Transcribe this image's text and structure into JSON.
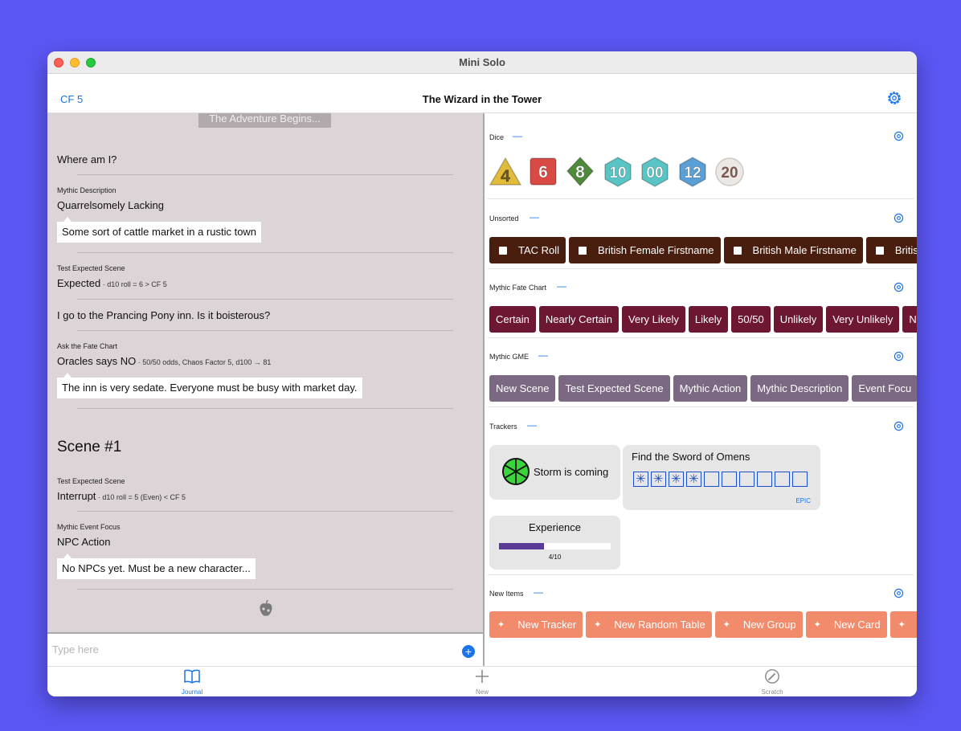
{
  "window": {
    "title": "Mini Solo"
  },
  "navbar": {
    "chaos_factor": "CF 5",
    "title": "The Wizard in the Tower"
  },
  "journal": {
    "adventure_banner": "The Adventure Begins...",
    "entries": [
      {
        "text": "Where am I?"
      },
      {
        "label": "Mythic Description",
        "text": "Quarrelsomely Lacking",
        "note": "Some sort of cattle market in a rustic town"
      },
      {
        "label": "Test Expected Scene",
        "text": "Expected",
        "detail": " · d10 roll = 6 > CF 5"
      },
      {
        "text": "I go to the Prancing Pony inn. Is it boisterous?"
      },
      {
        "label": "Ask the Fate Chart",
        "text": "Oracles says NO",
        "detail": " · 50/50 odds, Chaos Factor 5, d100 → 81",
        "note": "The inn is very sedate. Everyone must be busy with market day."
      },
      {
        "scene_title": "Scene #1"
      },
      {
        "label": "Test Expected Scene",
        "text": "Interrupt",
        "detail": " · d10 roll = 5 (Even) < CF 5"
      },
      {
        "label": "Mythic Event Focus",
        "text": "NPC Action",
        "note": "No NPCs yet. Must be a new character..."
      }
    ],
    "input_placeholder": "Type here"
  },
  "panel": {
    "dice": {
      "label": "Dice",
      "values": [
        "4",
        "6",
        "8",
        "10",
        "00",
        "12",
        "20"
      ],
      "colors": [
        "#e2bb3a",
        "#d94a45",
        "#4f8a3a",
        "#58c4c4",
        "#58c4c4",
        "#5a9fd6",
        "#ece8e6"
      ]
    },
    "unsorted": {
      "label": "Unsorted",
      "items": [
        "TAC Roll",
        "British Female Firstname",
        "British Male Firstname",
        "British S"
      ]
    },
    "fate_chart": {
      "label": "Mythic Fate Chart",
      "items": [
        "Certain",
        "Nearly Certain",
        "Very Likely",
        "Likely",
        "50/50",
        "Unlikely",
        "Very Unlikely",
        "N"
      ]
    },
    "gme": {
      "label": "Mythic GME",
      "items": [
        "New Scene",
        "Test Expected Scene",
        "Mythic Action",
        "Mythic Description",
        "Event Focu"
      ]
    },
    "trackers": {
      "label": "Trackers",
      "storm": {
        "label": "Storm is coming"
      },
      "sword": {
        "title": "Find the Sword of Omens",
        "filled": 4,
        "total": 10,
        "tag": "EPIC"
      },
      "experience": {
        "title": "Experience",
        "value": 4,
        "max": 10,
        "value_text": "4/10"
      }
    },
    "new_items": {
      "label": "New Items",
      "items": [
        "New Tracker",
        "New Random Table",
        "New Group",
        "New Card",
        "N"
      ]
    }
  },
  "tabbar": {
    "tabs": [
      {
        "label": "Journal"
      },
      {
        "label": "New"
      },
      {
        "label": "Scratch"
      }
    ]
  },
  "colors": {
    "accent": "#1b74e8",
    "journal_bg": "#dcd4d6",
    "unsorted_chip": "#4a1e0e",
    "fate_chip": "#6e1733",
    "gme_chip": "#7b6882",
    "new_chip": "#f28b6b",
    "progress": "#5a3a96"
  }
}
